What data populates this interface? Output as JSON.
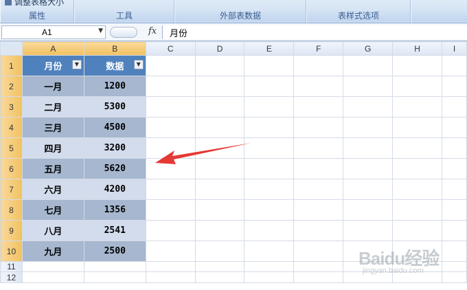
{
  "ribbon": {
    "cut_command": "调整表格大小",
    "groups": [
      {
        "label": "属性"
      },
      {
        "label": "工具"
      },
      {
        "label": "外部表数据"
      },
      {
        "label": "表样式选项"
      }
    ]
  },
  "formula_bar": {
    "name_box": "A1",
    "fx_symbol": "fx",
    "formula": "月份"
  },
  "sheet": {
    "columns": [
      "A",
      "B",
      "C",
      "D",
      "E",
      "F",
      "G",
      "H",
      "I"
    ],
    "rows": [
      "1",
      "2",
      "3",
      "4",
      "5",
      "6",
      "7",
      "8",
      "9",
      "10",
      "11",
      "12"
    ],
    "table_headers": [
      "月份",
      "数据"
    ],
    "table_rows": [
      {
        "month": "一月",
        "value": "1200"
      },
      {
        "month": "二月",
        "value": "5300"
      },
      {
        "month": "三月",
        "value": "4500"
      },
      {
        "month": "四月",
        "value": "3200"
      },
      {
        "month": "五月",
        "value": "5620"
      },
      {
        "month": "六月",
        "value": "4200"
      },
      {
        "month": "七月",
        "value": "1356"
      },
      {
        "month": "八月",
        "value": "2541"
      },
      {
        "month": "九月",
        "value": "2500"
      }
    ]
  },
  "colors": {
    "header_fill": "#4f81bd",
    "band_dark": "#a6b7cf",
    "band_light": "#d3dcec",
    "arrow": "#e53935"
  },
  "watermark": {
    "logo": "Baidu经验",
    "site": "jingyan.baidu.com"
  }
}
